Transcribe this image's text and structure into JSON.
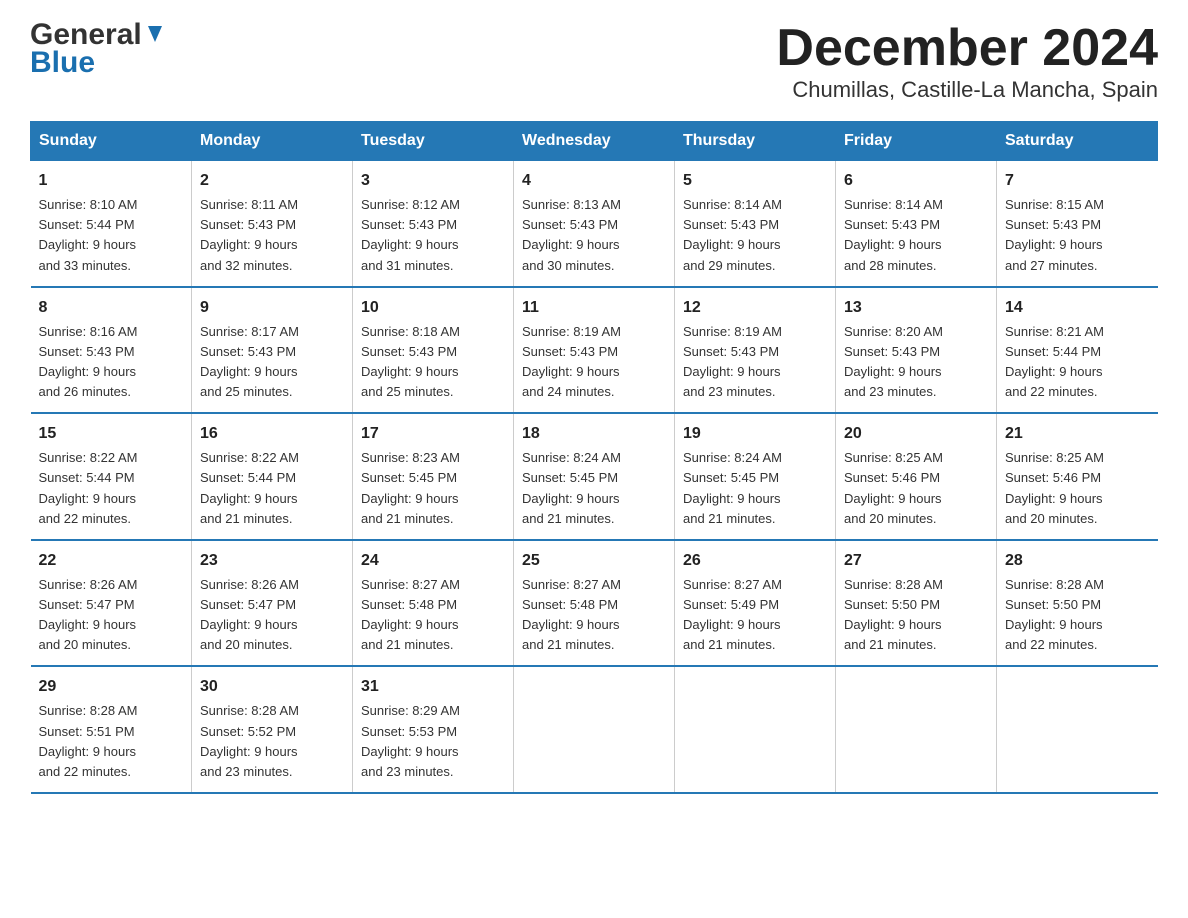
{
  "logo": {
    "general": "General",
    "blue": "Blue",
    "arrow": "▲"
  },
  "title": "December 2024",
  "subtitle": "Chumillas, Castille-La Mancha, Spain",
  "days_of_week": [
    "Sunday",
    "Monday",
    "Tuesday",
    "Wednesday",
    "Thursday",
    "Friday",
    "Saturday"
  ],
  "weeks": [
    [
      {
        "day": "1",
        "sunrise": "8:10 AM",
        "sunset": "5:44 PM",
        "daylight": "9 hours and 33 minutes."
      },
      {
        "day": "2",
        "sunrise": "8:11 AM",
        "sunset": "5:43 PM",
        "daylight": "9 hours and 32 minutes."
      },
      {
        "day": "3",
        "sunrise": "8:12 AM",
        "sunset": "5:43 PM",
        "daylight": "9 hours and 31 minutes."
      },
      {
        "day": "4",
        "sunrise": "8:13 AM",
        "sunset": "5:43 PM",
        "daylight": "9 hours and 30 minutes."
      },
      {
        "day": "5",
        "sunrise": "8:14 AM",
        "sunset": "5:43 PM",
        "daylight": "9 hours and 29 minutes."
      },
      {
        "day": "6",
        "sunrise": "8:14 AM",
        "sunset": "5:43 PM",
        "daylight": "9 hours and 28 minutes."
      },
      {
        "day": "7",
        "sunrise": "8:15 AM",
        "sunset": "5:43 PM",
        "daylight": "9 hours and 27 minutes."
      }
    ],
    [
      {
        "day": "8",
        "sunrise": "8:16 AM",
        "sunset": "5:43 PM",
        "daylight": "9 hours and 26 minutes."
      },
      {
        "day": "9",
        "sunrise": "8:17 AM",
        "sunset": "5:43 PM",
        "daylight": "9 hours and 25 minutes."
      },
      {
        "day": "10",
        "sunrise": "8:18 AM",
        "sunset": "5:43 PM",
        "daylight": "9 hours and 25 minutes."
      },
      {
        "day": "11",
        "sunrise": "8:19 AM",
        "sunset": "5:43 PM",
        "daylight": "9 hours and 24 minutes."
      },
      {
        "day": "12",
        "sunrise": "8:19 AM",
        "sunset": "5:43 PM",
        "daylight": "9 hours and 23 minutes."
      },
      {
        "day": "13",
        "sunrise": "8:20 AM",
        "sunset": "5:43 PM",
        "daylight": "9 hours and 23 minutes."
      },
      {
        "day": "14",
        "sunrise": "8:21 AM",
        "sunset": "5:44 PM",
        "daylight": "9 hours and 22 minutes."
      }
    ],
    [
      {
        "day": "15",
        "sunrise": "8:22 AM",
        "sunset": "5:44 PM",
        "daylight": "9 hours and 22 minutes."
      },
      {
        "day": "16",
        "sunrise": "8:22 AM",
        "sunset": "5:44 PM",
        "daylight": "9 hours and 21 minutes."
      },
      {
        "day": "17",
        "sunrise": "8:23 AM",
        "sunset": "5:45 PM",
        "daylight": "9 hours and 21 minutes."
      },
      {
        "day": "18",
        "sunrise": "8:24 AM",
        "sunset": "5:45 PM",
        "daylight": "9 hours and 21 minutes."
      },
      {
        "day": "19",
        "sunrise": "8:24 AM",
        "sunset": "5:45 PM",
        "daylight": "9 hours and 21 minutes."
      },
      {
        "day": "20",
        "sunrise": "8:25 AM",
        "sunset": "5:46 PM",
        "daylight": "9 hours and 20 minutes."
      },
      {
        "day": "21",
        "sunrise": "8:25 AM",
        "sunset": "5:46 PM",
        "daylight": "9 hours and 20 minutes."
      }
    ],
    [
      {
        "day": "22",
        "sunrise": "8:26 AM",
        "sunset": "5:47 PM",
        "daylight": "9 hours and 20 minutes."
      },
      {
        "day": "23",
        "sunrise": "8:26 AM",
        "sunset": "5:47 PM",
        "daylight": "9 hours and 20 minutes."
      },
      {
        "day": "24",
        "sunrise": "8:27 AM",
        "sunset": "5:48 PM",
        "daylight": "9 hours and 21 minutes."
      },
      {
        "day": "25",
        "sunrise": "8:27 AM",
        "sunset": "5:48 PM",
        "daylight": "9 hours and 21 minutes."
      },
      {
        "day": "26",
        "sunrise": "8:27 AM",
        "sunset": "5:49 PM",
        "daylight": "9 hours and 21 minutes."
      },
      {
        "day": "27",
        "sunrise": "8:28 AM",
        "sunset": "5:50 PM",
        "daylight": "9 hours and 21 minutes."
      },
      {
        "day": "28",
        "sunrise": "8:28 AM",
        "sunset": "5:50 PM",
        "daylight": "9 hours and 22 minutes."
      }
    ],
    [
      {
        "day": "29",
        "sunrise": "8:28 AM",
        "sunset": "5:51 PM",
        "daylight": "9 hours and 22 minutes."
      },
      {
        "day": "30",
        "sunrise": "8:28 AM",
        "sunset": "5:52 PM",
        "daylight": "9 hours and 23 minutes."
      },
      {
        "day": "31",
        "sunrise": "8:29 AM",
        "sunset": "5:53 PM",
        "daylight": "9 hours and 23 minutes."
      },
      null,
      null,
      null,
      null
    ]
  ],
  "labels": {
    "sunrise": "Sunrise:",
    "sunset": "Sunset:",
    "daylight": "Daylight:"
  },
  "header_bg": "#2578b5"
}
